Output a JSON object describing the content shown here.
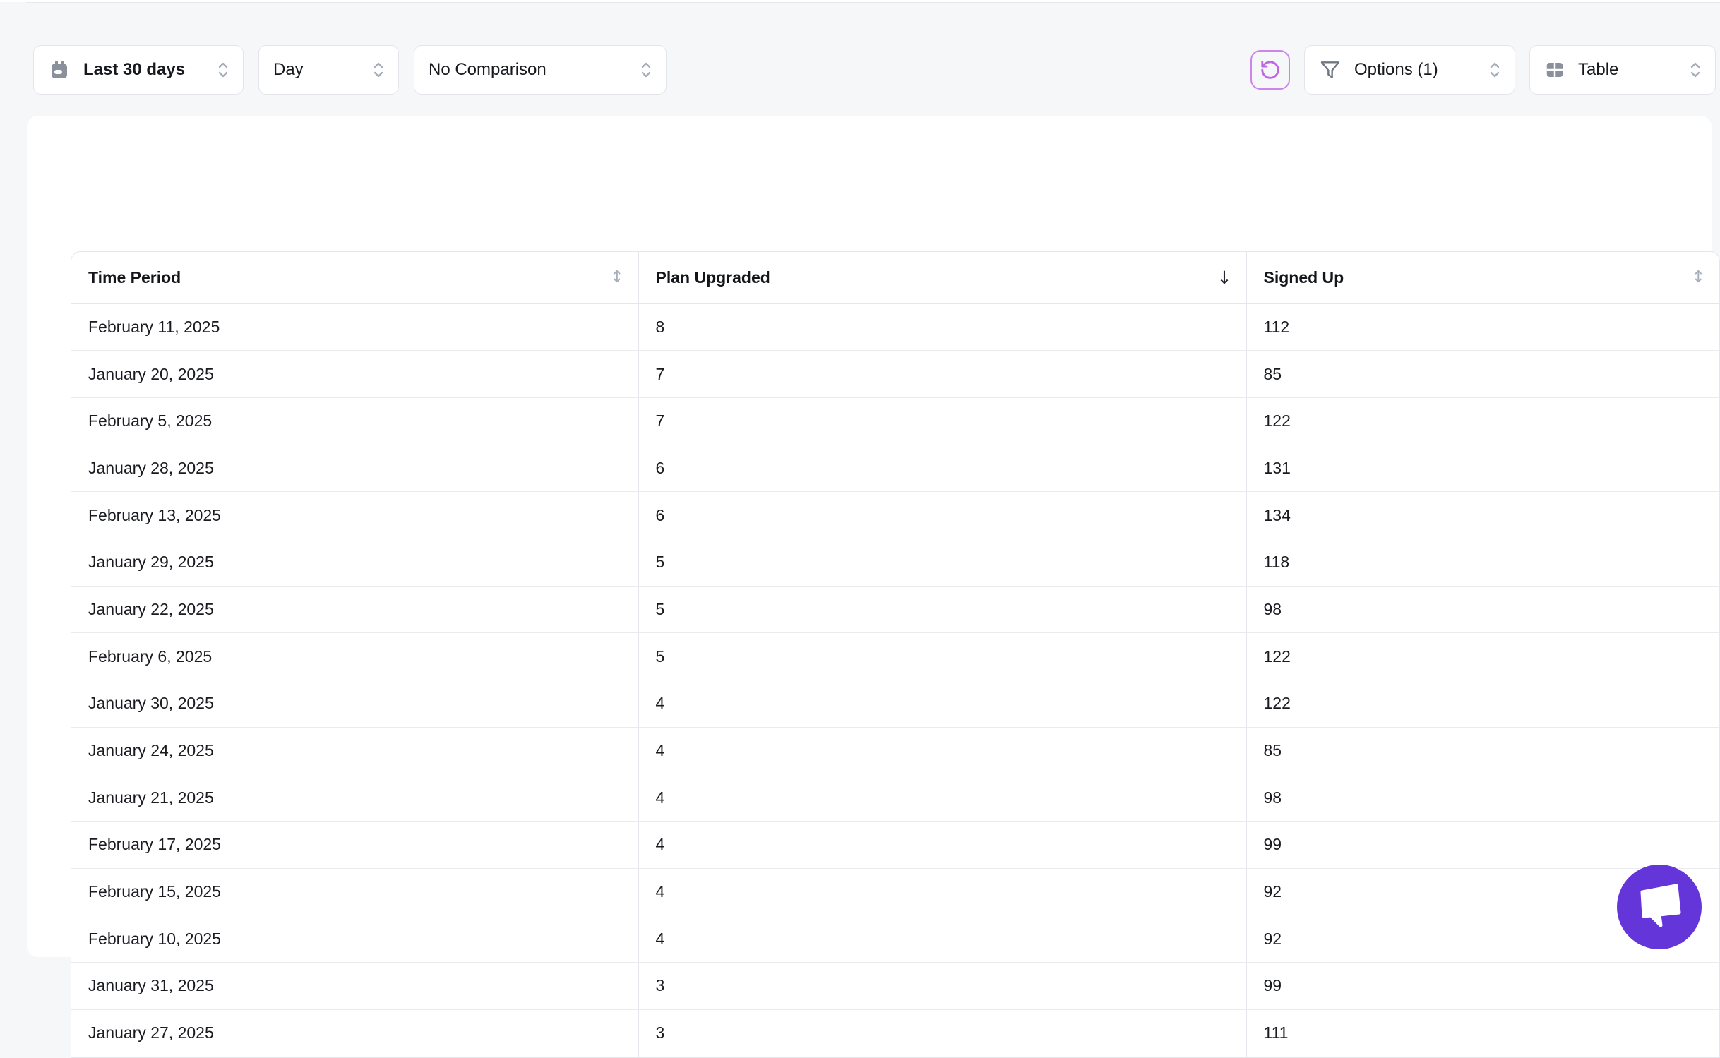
{
  "toolbar": {
    "date_range_label": "Last 30 days",
    "granularity_label": "Day",
    "comparison_label": "No Comparison",
    "options_label": "Options (1)",
    "view_label": "Table"
  },
  "table": {
    "columns": [
      {
        "label": "Time Period",
        "sort": "none"
      },
      {
        "label": "Plan Upgraded",
        "sort": "desc"
      },
      {
        "label": "Signed Up",
        "sort": "none"
      }
    ],
    "rows": [
      [
        "February 11, 2025",
        "8",
        "112"
      ],
      [
        "January 20, 2025",
        "7",
        "85"
      ],
      [
        "February 5, 2025",
        "7",
        "122"
      ],
      [
        "January 28, 2025",
        "6",
        "131"
      ],
      [
        "February 13, 2025",
        "6",
        "134"
      ],
      [
        "January 29, 2025",
        "5",
        "118"
      ],
      [
        "January 22, 2025",
        "5",
        "98"
      ],
      [
        "February 6, 2025",
        "5",
        "122"
      ],
      [
        "January 30, 2025",
        "4",
        "122"
      ],
      [
        "January 24, 2025",
        "4",
        "85"
      ],
      [
        "January 21, 2025",
        "4",
        "98"
      ],
      [
        "February 17, 2025",
        "4",
        "99"
      ],
      [
        "February 15, 2025",
        "4",
        "92"
      ],
      [
        "February 10, 2025",
        "4",
        "92"
      ],
      [
        "January 31, 2025",
        "3",
        "99"
      ],
      [
        "January 27, 2025",
        "3",
        "111"
      ]
    ]
  },
  "icons": {
    "sort_both": "↕",
    "sort_desc": "↓"
  },
  "colors": {
    "accent_undo_purple": "#bf68e6",
    "chat_purple": "#6435d9",
    "icon_gray": "#8a919c"
  }
}
